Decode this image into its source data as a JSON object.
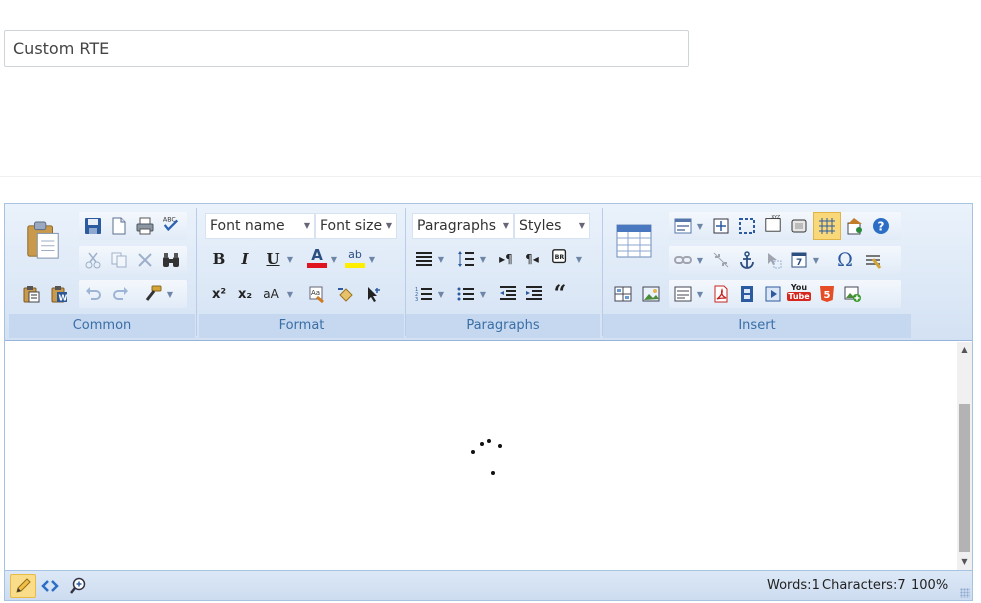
{
  "title_field": {
    "value": "Custom RTE"
  },
  "ribbon": {
    "groups": [
      {
        "label": "Common"
      },
      {
        "label": "Format"
      },
      {
        "label": "Paragraphs"
      },
      {
        "label": "Insert"
      }
    ],
    "combos": {
      "font_name": "Font name",
      "font_size": "Font size",
      "paragraphs": "Paragraphs",
      "styles": "Styles"
    },
    "format_glyphs": {
      "bold": "B",
      "italic": "I",
      "underline": "U",
      "font_color": "A",
      "highlight": "ab",
      "superscript": "x²",
      "subscript": "x₂",
      "change_case": "aA"
    },
    "insert_glyphs": {
      "special_chars": "Ω",
      "youtube_top": "You",
      "youtube_bottom": "Tube",
      "html5": "5"
    },
    "colors": {
      "font_color_bar": "#e0141e",
      "highlight_bar": "#ffee00"
    }
  },
  "status": {
    "words": "Words:1",
    "characters": "Characters:7",
    "zoom": "100%"
  },
  "icons": [
    "paste-icon",
    "save-icon",
    "new-doc-icon",
    "print-icon",
    "spellcheck-icon",
    "cut-icon",
    "copy-icon",
    "delete-icon",
    "find-icon",
    "paste-text-icon",
    "paste-word-icon",
    "undo-icon",
    "redo-icon",
    "format-painter-icon"
  ]
}
